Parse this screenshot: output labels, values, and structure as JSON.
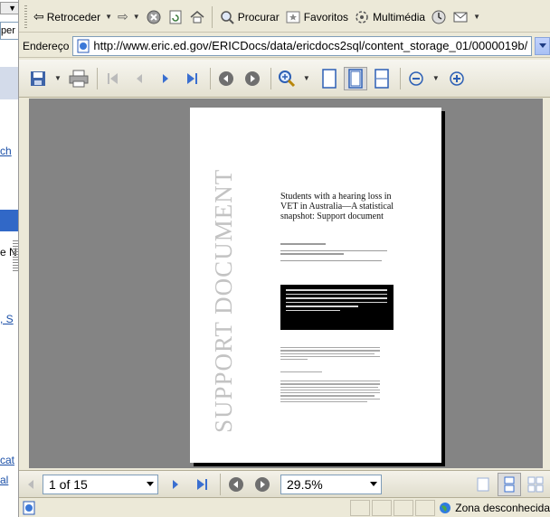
{
  "left_strip": {
    "dropdown_fragment": "▼",
    "field_fragment": "per",
    "link1_fragment": "ch",
    "text_fragment": "e N",
    "link2_fragment": ", S",
    "link3_fragment": "cat",
    "link4_fragment": "al"
  },
  "toolbar": {
    "back_label": "Retroceder",
    "search_label": "Procurar",
    "favorites_label": "Favoritos",
    "media_label": "Multimédia"
  },
  "address": {
    "label": "Endereço",
    "url": "http://www.eric.ed.gov/ERICDocs/data/ericdocs2sql/content_storage_01/0000019b/"
  },
  "document": {
    "vertical_title": "SUPPORT DOCUMENT",
    "title": "Students with a hearing loss in VET in Australia—A statistical snapshot: Support document"
  },
  "navigation": {
    "page_indicator": "1 of 15",
    "zoom": "29.5%"
  },
  "status": {
    "zone_label": "Zona desconhecida"
  },
  "colors": {
    "chrome": "#ece9d8",
    "viewer_bg": "#848484",
    "link": "#1a4fa7"
  }
}
